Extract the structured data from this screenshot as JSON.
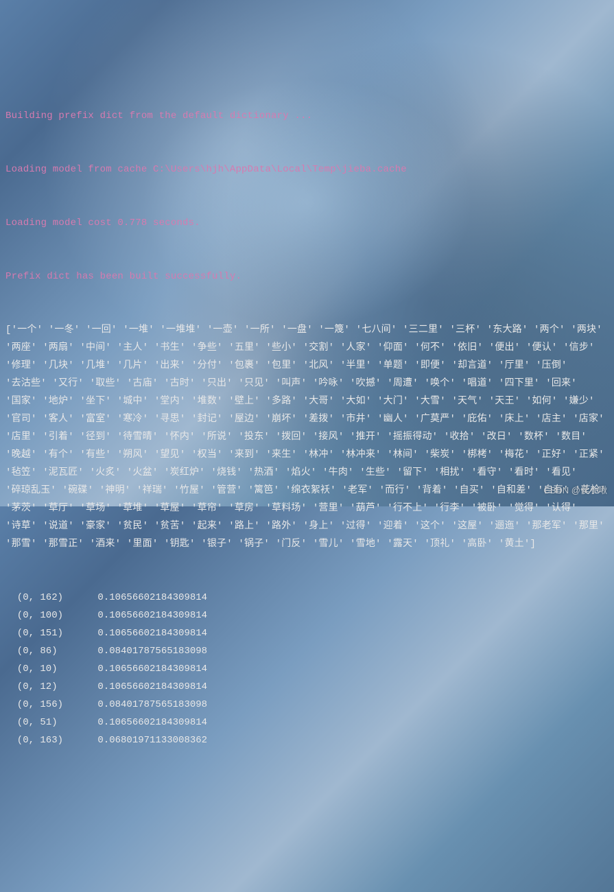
{
  "log": {
    "line1": "Building prefix dict from the default dictionary ...",
    "line2": "Loading model from cache C:\\Users\\hjh\\AppData\\Local\\Temp\\jieba.cache",
    "line3": "Loading model cost 0.778 seconds.",
    "line4": "Prefix dict has been built successfully."
  },
  "tokens": "['一个' '一冬' '一回' '一堆' '一堆堆' '一壶' '一所' '一盘' '一篾' '七八间' '三二里' '三杯' '东大路' '两个' '两块' '两座' '两扇' '中间' '主人' '书生' '争些' '五里' '些小' '交割' '人家' '仰面' '何不' '依旧' '便出' '便认' '信步' '修理' '几块' '几堆' '几片' '出来' '分付' '包裹' '包里' '北风' '半里' '单题' '即便' '却言道' '厅里' '压倒' '去沽些' '又行' '取些' '古庙' '古时' '只出' '只见' '叫声' '吟咏' '吹撼' '周遭' '唤个' '唱道' '四下里' '回来' '国家' '地炉' '坐下' '城中' '堂内' '堆数' '壁上' '多路' '大哥' '大如' '大门' '大雪' '天气' '天王' '如何' '嫌少' '官司' '客人' '富室' '寒冷' '寻思' '封记' '屋边' '崩坏' '差拨' '市井' '幽人' '广莫严' '庇佑' '床上' '店主' '店家' '店里' '引着' '径到' '待雪晴' '怀内' '所说' '投东' '拨回' '接风' '推开' '摇振得动' '收拾' '改日' '数杯' '数目' '晚越' '有个' '有些' '朔风' '望见' '权当' '来到' '来生' '林冲' '林冲来' '林间' '柴炭' '梆栲' '梅花' '正好' '正紧' '毡笠' '泥瓦匠' '火炙' '火盆' '炭红炉' '烧钱' '热酒' '焰火' '牛肉' '生些' '留下' '相扰' '看守' '看时' '看见' '碎琼乱玉' '碗碟' '神明' '祥瑞' '竹屋' '管营' '篱笆' '绵衣絮袄' '老军' '而行' '背着' '自买' '自和差' '自有' '花枪' '茅茨' '草厅' '草场' '草堆' '草屋' '草帘' '草房' '草料场' '营里' '葫芦' '行不上' '行李' '被卧' '觉得' '认得' '诗草' '说道' '豪家' '贫民' '贫苦' '起来' '路上' '路外' '身上' '过得' '迎着' '这个' '这屋' '逦迤' '那老军' '那里' '那雪' '那雪正' '酒来' '里面' '钥匙' '银子' '锅子' '门反' '雪儿' '雪地' '露天' '顶礼' '高卧' '黄土']",
  "matrix": [
    {
      "coord": "  (0, 162)",
      "value": "0.10656602184309814"
    },
    {
      "coord": "  (0, 100)",
      "value": "0.10656602184309814"
    },
    {
      "coord": "  (0, 151)",
      "value": "0.10656602184309814"
    },
    {
      "coord": "  (0, 86) ",
      "value": "0.08401787565183098"
    },
    {
      "coord": "  (0, 10) ",
      "value": "0.10656602184309814"
    },
    {
      "coord": "  (0, 12) ",
      "value": "0.10656602184309814"
    },
    {
      "coord": "  (0, 156)",
      "value": "0.08401787565183098"
    },
    {
      "coord": "  (0, 51) ",
      "value": "0.10656602184309814"
    },
    {
      "coord": "  (0, 163)",
      "value": "0.06801971133008362"
    }
  ],
  "watermark": "CSDN @侯小啾"
}
